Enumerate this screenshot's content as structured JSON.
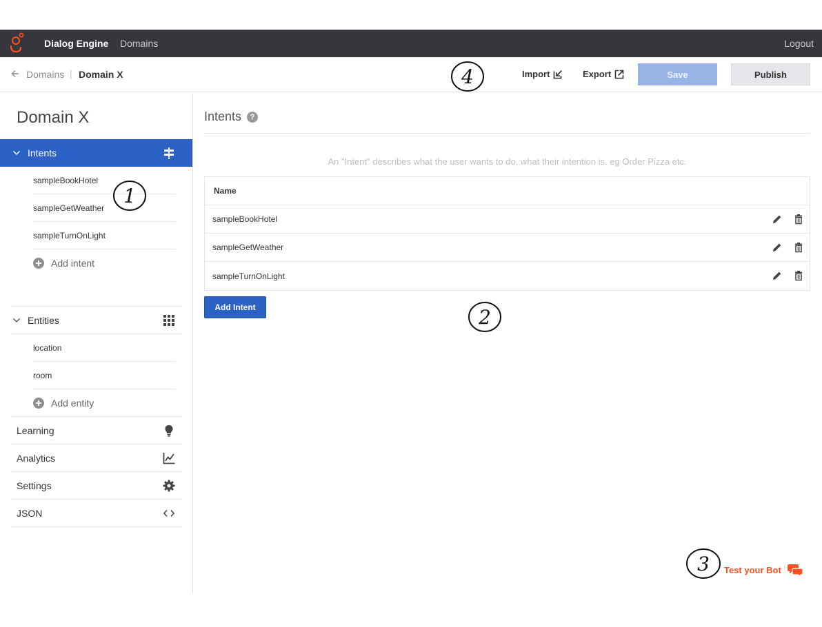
{
  "topbar": {
    "app_title": "Dialog Engine",
    "nav_domains": "Domains",
    "logout": "Logout"
  },
  "subheader": {
    "breadcrumb_parent": "Domains",
    "breadcrumb_separator": "|",
    "breadcrumb_current": "Domain X",
    "import_label": "Import",
    "export_label": "Export",
    "save_label": "Save",
    "publish_label": "Publish"
  },
  "sidebar": {
    "domain_title": "Domain X",
    "intents_label": "Intents",
    "intents": [
      "sampleBookHotel",
      "sampleGetWeather",
      "sampleTurnOnLight"
    ],
    "add_intent_label": "Add intent",
    "entities_label": "Entities",
    "entities": [
      "location",
      "room"
    ],
    "add_entity_label": "Add entity",
    "learning_label": "Learning",
    "analytics_label": "Analytics",
    "settings_label": "Settings",
    "json_label": "JSON"
  },
  "main": {
    "heading": "Intents",
    "help_glyph": "?",
    "hint": "An \"Intent\" describes what the user wants to do, what their intention is. eg Order Pizza etc.",
    "table": {
      "name_header": "Name",
      "rows": [
        "sampleBookHotel",
        "sampleGetWeather",
        "sampleTurnOnLight"
      ]
    },
    "add_intent_button": "Add Intent"
  },
  "test_bot_label": "Test your Bot",
  "annotations": [
    "1",
    "2",
    "3",
    "4"
  ],
  "colors": {
    "topbar_bg": "#35373c",
    "accent_blue": "#2c61c5",
    "save_disabled": "#98b3e6",
    "test_bot_orange": "#ff4f1f",
    "logo_orange": "#ff4f1f"
  }
}
